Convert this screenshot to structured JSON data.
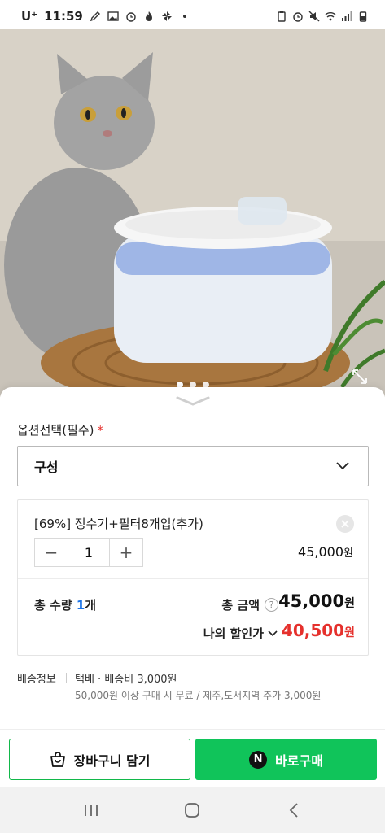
{
  "status_bar": {
    "carrier": "U⁺",
    "time": "11:59",
    "colors": {
      "text": "#222222"
    }
  },
  "hero": {
    "image_subject": "cat-and-water-fountain-photo",
    "page_indicator": {
      "total": 3,
      "active": 0
    },
    "expand_icon": "expand-icon"
  },
  "sheet": {
    "option_title": "옵션선택(필수)",
    "required_mark": "*",
    "select_value": "구성",
    "selected_option": {
      "name": "[69%] 정수기+필터8개입(추가)",
      "quantity": "1",
      "price": "45,000",
      "currency": "원"
    },
    "minus": "−",
    "plus": "+",
    "total_qty_label": "총 수량",
    "total_qty_value": "1",
    "total_qty_unit": "개",
    "total_amount_label": "총 금액",
    "help_mark": "?",
    "total_amount": "45,000",
    "total_currency": "원",
    "my_price_label": "나의 할인가",
    "my_price": "40,500",
    "my_price_currency": "원",
    "shipping_label": "배송정보",
    "shipping_main": "택배 · 배송비 3,000원",
    "shipping_sub": "50,000원 이상 구매 시 무료 / 제주,도서지역 추가 3,000원"
  },
  "actions": {
    "cart_label": "장바구니 담기",
    "buy_label": "바로구매",
    "buy_badge": "N",
    "colors": {
      "green": "#10c45a",
      "cart_border": "#12b84a"
    }
  },
  "colors": {
    "required_red": "#e5302c",
    "discount_red": "#e5302c",
    "qty_blue": "#1a73e8"
  }
}
